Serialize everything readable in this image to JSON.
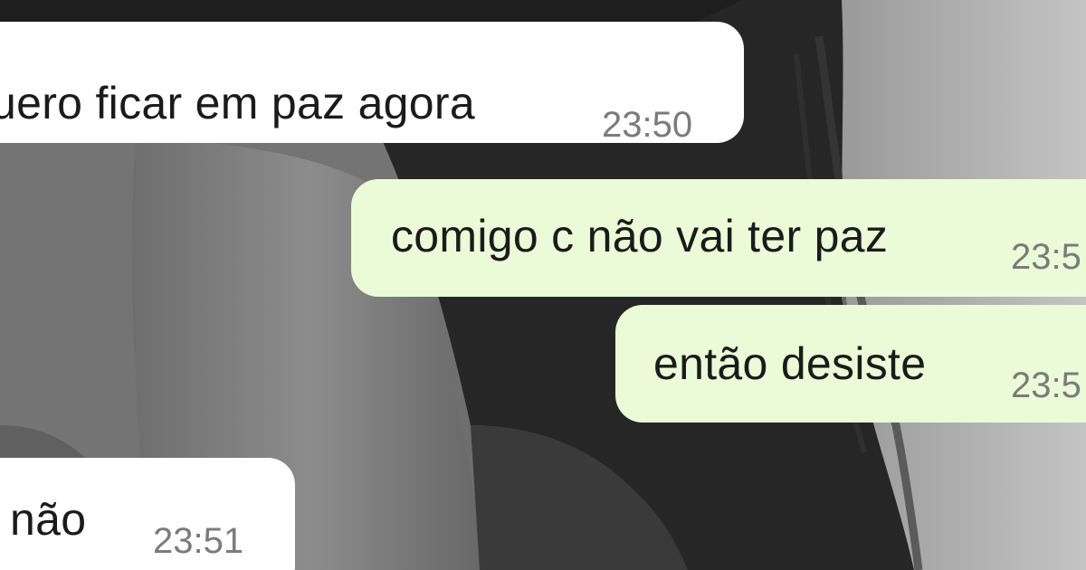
{
  "chat": {
    "messages": [
      {
        "direction": "incoming",
        "text": "uero ficar em paz agora",
        "time": "23:50"
      },
      {
        "direction": "outgoing",
        "text": "comigo c não vai ter paz",
        "time": "23:5"
      },
      {
        "direction": "outgoing",
        "text": "então desiste",
        "time": "23:5"
      },
      {
        "direction": "incoming",
        "text": "não",
        "time": "23:51"
      }
    ]
  },
  "colors": {
    "incoming_bubble": "#ffffff",
    "outgoing_bubble": "#ebfbd8",
    "message_text": "#1b1b1b",
    "timestamp_text": "#7b7b7b"
  }
}
